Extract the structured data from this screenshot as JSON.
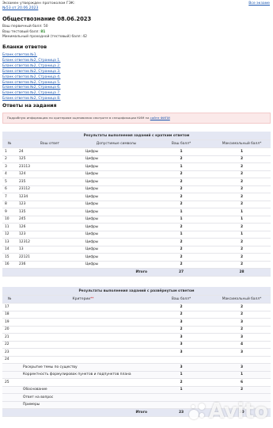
{
  "header": {
    "approved_text": "Экзамен утвержден протоколом ГЭК:",
    "protocol_link": "№53 от 20.06.2023",
    "back_link": "Все экзаме"
  },
  "exam": {
    "title": "Обществознание 08.06.2023",
    "primary_label": "Ваш первичный балл:",
    "primary_value": "50",
    "test_label": "Ваш тестовый балл:",
    "test_value": "81",
    "min_label": "Минимальный проходной (тестовый) балл:",
    "min_value": "42"
  },
  "forms": {
    "title": "Бланки ответов",
    "links": [
      "Бланк ответов №1.",
      "Бланк ответов №2, Страница 1.",
      "Бланк ответов №2, Страница 2.",
      "Бланк ответов №2, Страница 3.",
      "Бланк ответов №2, Страница 4.",
      "Бланк ответов №2, Страница 5.",
      "Бланк ответов №2, Страница 6.",
      "Бланк ответов №2, Страница 7.",
      "Бланк ответов №2, Страница 8."
    ]
  },
  "answers_title": "Ответы на задания",
  "info": {
    "text": "Подробную информацию по критериям оценивания смотрите в спецификации КИМ на",
    "link": "сайте ФИПИ"
  },
  "short_table": {
    "title": "Результаты выполнения заданий с кратким ответом",
    "headers": [
      "№",
      "Ваш ответ",
      "Допустимые символы",
      "Ваш балл*",
      "Максимальный балл*"
    ],
    "rows": [
      [
        "1",
        "24",
        "Цифры",
        "1",
        "1"
      ],
      [
        "2",
        "125",
        "Цифры",
        "2",
        "2"
      ],
      [
        "3",
        "23113",
        "Цифры",
        "1",
        "2"
      ],
      [
        "4",
        "124",
        "Цифры",
        "2",
        "2"
      ],
      [
        "5",
        "235",
        "Цифры",
        "2",
        "2"
      ],
      [
        "6",
        "23112",
        "Цифры",
        "2",
        "2"
      ],
      [
        "7",
        "1234",
        "Цифры",
        "2",
        "2"
      ],
      [
        "8",
        "123",
        "Цифры",
        "2",
        "2"
      ],
      [
        "9",
        "135",
        "Цифры",
        "1",
        "1"
      ],
      [
        "10",
        "245",
        "Цифры",
        "1",
        "1"
      ],
      [
        "11",
        "126",
        "Цифры",
        "2",
        "2"
      ],
      [
        "12",
        "123",
        "Цифры",
        "1",
        "1"
      ],
      [
        "13",
        "12312",
        "Цифры",
        "2",
        "2"
      ],
      [
        "14",
        "13",
        "Цифры",
        "2",
        "2"
      ],
      [
        "15",
        "22121",
        "Цифры",
        "2",
        "2"
      ],
      [
        "16",
        "236",
        "Цифры",
        "2",
        "2"
      ]
    ],
    "total_label": "Итого",
    "total_score": "27",
    "total_max": "28"
  },
  "long_table": {
    "title": "Результаты выполнения заданий с развёрнутым ответом",
    "headers": [
      "№",
      "Критерии",
      "**",
      "Ваш балл*",
      "Максимальный балл*"
    ],
    "rows": [
      {
        "n": "17",
        "crit": "",
        "score": "2",
        "max": "2",
        "sub": false
      },
      {
        "n": "18",
        "crit": "",
        "score": "2",
        "max": "2",
        "sub": false
      },
      {
        "n": "19",
        "crit": "",
        "score": "3",
        "max": "3",
        "sub": false
      },
      {
        "n": "20",
        "crit": "",
        "score": "2",
        "max": "2",
        "sub": false
      },
      {
        "n": "21",
        "crit": "",
        "score": "3",
        "max": "3",
        "sub": false
      },
      {
        "n": "22",
        "crit": "",
        "score": "3",
        "max": "4",
        "sub": false
      },
      {
        "n": "23",
        "crit": "",
        "score": "3",
        "max": "3",
        "sub": false
      },
      {
        "n": "24",
        "crit": "",
        "score": "",
        "max": "",
        "sub": false
      },
      {
        "n": "",
        "crit": "Раскрытие темы по существу",
        "score": "3",
        "max": "3",
        "sub": true
      },
      {
        "n": "",
        "crit": "Корректность формулировок пунктов и подпунктов плана",
        "score": "1",
        "max": "1",
        "sub": true
      },
      {
        "n": "25",
        "crit": "",
        "score": "2",
        "max": "6",
        "sub": false
      },
      {
        "n": "",
        "crit": "Обоснование",
        "score": "1",
        "max": "2",
        "sub": true
      },
      {
        "n": "",
        "crit": "Ответ на вопрос",
        "score": "",
        "max": "",
        "sub": true
      },
      {
        "n": "",
        "crit": "Примеры",
        "score": "",
        "max": "",
        "sub": true
      }
    ],
    "total_label": "Итого",
    "total_score": "23",
    "total_max": "30"
  },
  "watermark": "Avito"
}
